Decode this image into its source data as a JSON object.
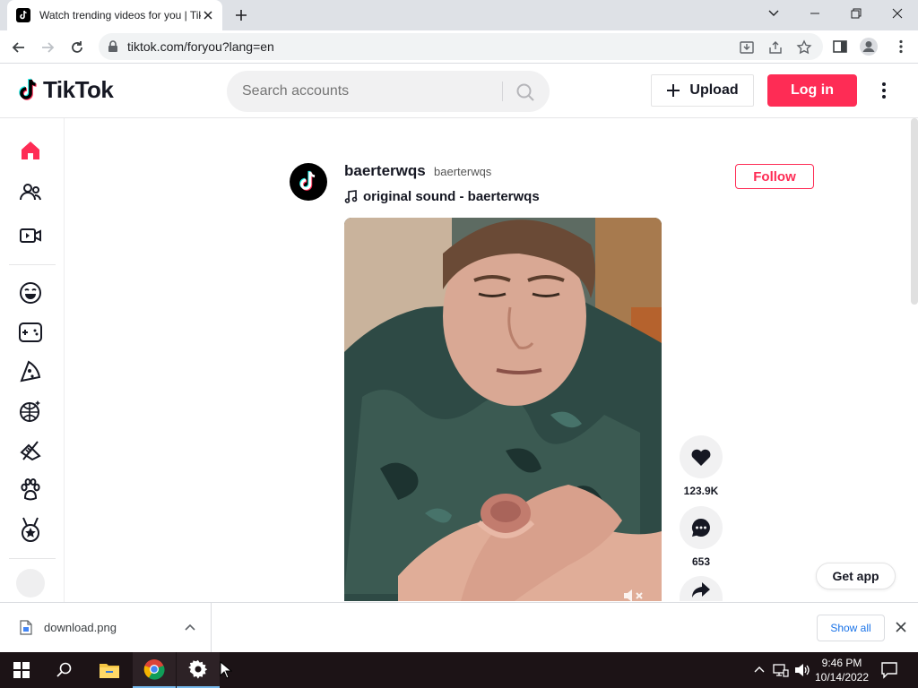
{
  "browser": {
    "tab_title": "Watch trending videos for you | TikTok",
    "url": "tiktok.com/foryou?lang=en"
  },
  "header": {
    "logo_text": "TikTok",
    "search_placeholder": "Search accounts",
    "upload_label": "Upload",
    "login_label": "Log in"
  },
  "sidebar": {
    "items": [
      "home-icon",
      "following-icon",
      "live-icon",
      "comedy-icon",
      "gaming-icon",
      "food-icon",
      "dance-icon",
      "beauty-icon",
      "animals-icon",
      "sports-icon"
    ]
  },
  "post": {
    "username": "baerterwqs",
    "nickname": "baerterwqs",
    "sound": "original sound - baerterwqs",
    "follow_label": "Follow",
    "likes": "123.9K",
    "comments": "653"
  },
  "get_app_label": "Get app",
  "download_bar": {
    "filename": "download.png",
    "show_all_label": "Show all"
  },
  "taskbar": {
    "time": "9:46 PM",
    "date": "10/14/2022"
  },
  "colors": {
    "brand": "#fe2c55",
    "text": "#161823"
  }
}
